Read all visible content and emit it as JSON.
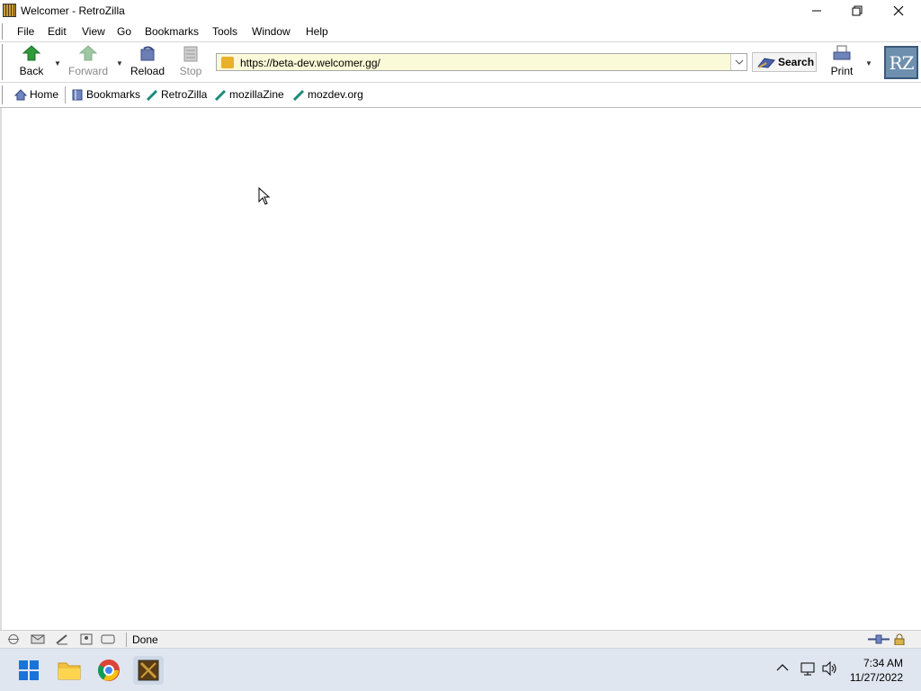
{
  "window": {
    "title": "Welcomer - RetroZilla",
    "minimize_glyph": "—",
    "restore_glyph": "❐",
    "close_glyph": "✕"
  },
  "menu": {
    "file": "File",
    "edit": "Edit",
    "view": "View",
    "go": "Go",
    "bookmarks": "Bookmarks",
    "tools": "Tools",
    "window": "Window",
    "help": "Help"
  },
  "toolbar": {
    "back": "Back",
    "forward": "Forward",
    "reload": "Reload",
    "stop": "Stop",
    "search": "Search",
    "print": "Print",
    "logo": "RZ"
  },
  "address": {
    "url": "https://beta-dev.welcomer.gg/"
  },
  "bookmarks_bar": {
    "home": "Home",
    "bookmarks": "Bookmarks",
    "retrozilla": "RetroZilla",
    "mozillazine": "mozillaZine",
    "mozdev": "mozdev.org"
  },
  "status": {
    "text": "Done"
  },
  "taskbar": {
    "time": "7:34 AM",
    "date": "11/27/2022"
  },
  "colors": {
    "url_bg": "#fbfad8",
    "taskbar_bg": "#dfe6f0",
    "logo_bg": "#6e8fae"
  }
}
